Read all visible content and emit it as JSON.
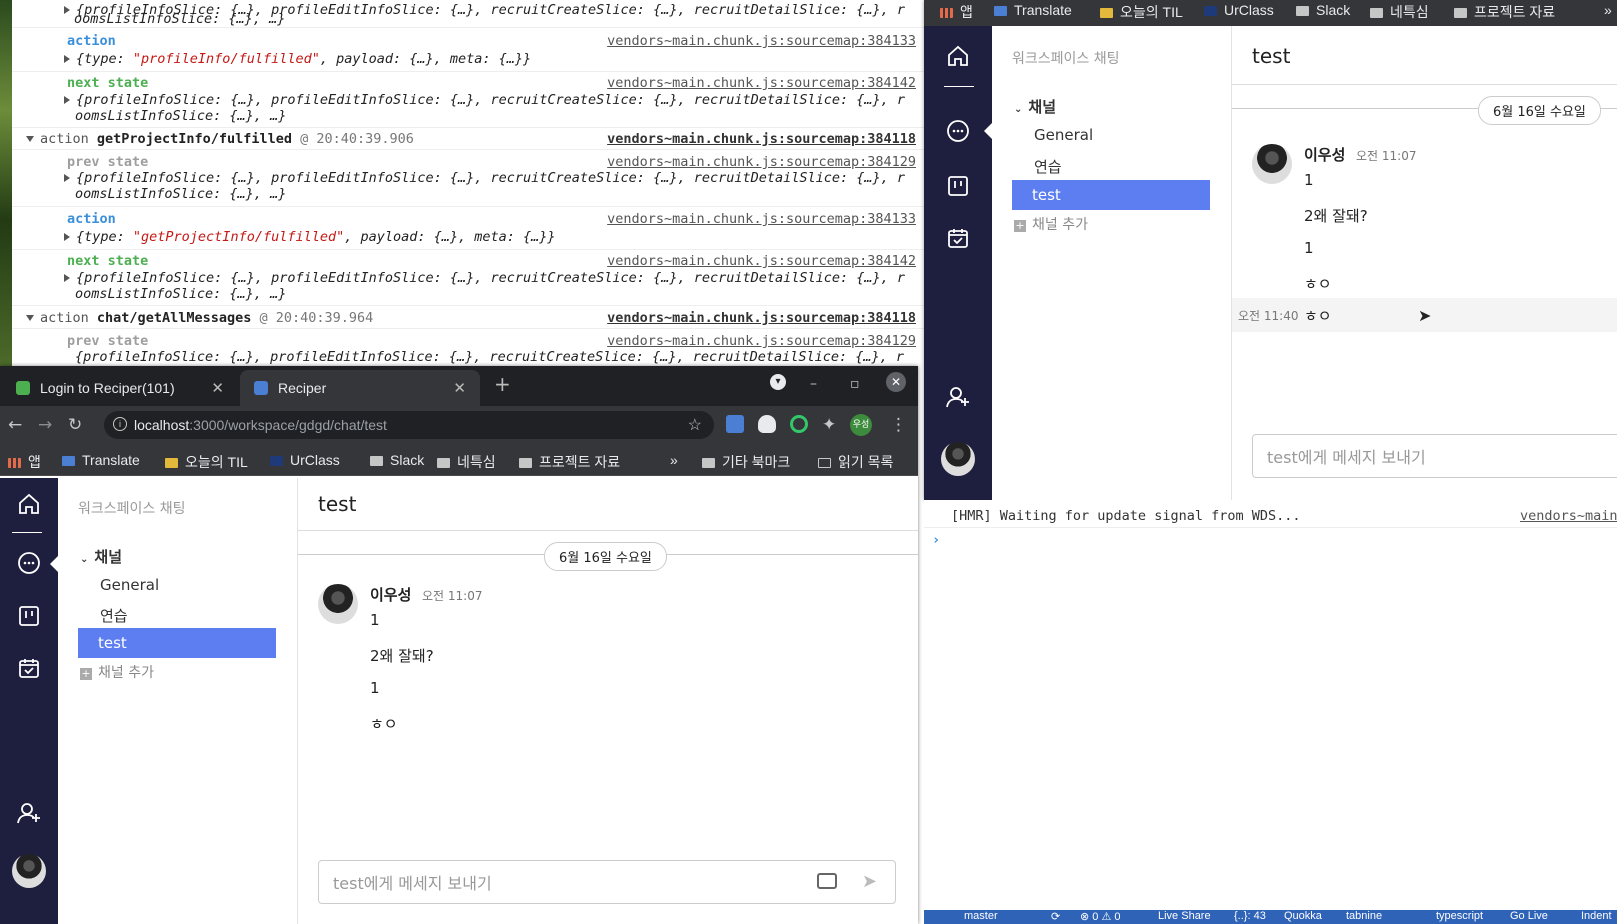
{
  "console": {
    "rows": [
      {
        "text": "{profileInfoSlice: {…}, profileEditInfoSlice: {…}, recruitCreateSlice: {…}, recruitDetailSlice: {…}, r"
      },
      {
        "text": "oomsListInfoSlice: {…}, …}"
      }
    ],
    "group1": {
      "action_label": "action",
      "action_src": "vendors~main.chunk.js:sourcemap:384133",
      "action_obj_pre": "{type: ",
      "action_type": "\"profileInfo/fulfilled\"",
      "action_obj_post": ", payload: {…}, meta: {…}}",
      "next_label": "next state",
      "next_src": "vendors~main.chunk.js:sourcemap:384142",
      "next_line1": "{profileInfoSlice: {…}, profileEditInfoSlice: {…}, recruitCreateSlice: {…}, recruitDetailSlice: {…}, r",
      "next_line2": "oomsListInfoSlice: {…}, …}"
    },
    "group2": {
      "header_action": "action",
      "header_name": "getProjectInfo/fulfilled",
      "header_time": "@ 20:40:39.906",
      "header_src": "vendors~main.chunk.js:sourcemap:384118",
      "prev_label": "prev state",
      "prev_src": "vendors~main.chunk.js:sourcemap:384129",
      "prev_line1": "{profileInfoSlice: {…}, profileEditInfoSlice: {…}, recruitCreateSlice: {…}, recruitDetailSlice: {…}, r",
      "prev_line2": "oomsListInfoSlice: {…}, …}",
      "action_label": "action",
      "action_src": "vendors~main.chunk.js:sourcemap:384133",
      "action_obj_pre": "{type: ",
      "action_type": "\"getProjectInfo/fulfilled\"",
      "action_obj_post": ", payload: {…}, meta: {…}}",
      "next_label": "next state",
      "next_src": "vendors~main.chunk.js:sourcemap:384142",
      "next_line1": "{profileInfoSlice: {…}, profileEditInfoSlice: {…}, recruitCreateSlice: {…}, recruitDetailSlice: {…}, r",
      "next_line2": "oomsListInfoSlice: {…}, …}"
    },
    "group3": {
      "header_action": "action",
      "header_name": "chat/getAllMessages",
      "header_time": "@ 20:40:39.964",
      "header_src": "vendors~main.chunk.js:sourcemap:384118",
      "prev_label": "prev state",
      "prev_src": "vendors~main.chunk.js:sourcemap:384129",
      "prev_line1": "{profileInfoSlice: {…}, profileEditInfoSlice: {…}, recruitCreateSlice: {…}, recruitDetailSlice: {…}, r"
    }
  },
  "browser": {
    "tabs": [
      {
        "label": "Login to Reciper(101)",
        "favicon_color": "#4caf50"
      },
      {
        "label": "Reciper",
        "favicon_color": "#4a7fd4"
      }
    ],
    "url_host": "localhost",
    "url_path": ":3000/workspace/gdgd/chat/test",
    "bookmarks": [
      "앱",
      "Translate",
      "오늘의 TIL",
      "UrClass",
      "Slack",
      "네특심",
      "프로젝트 자료",
      "»",
      "기타 북마크",
      "읽기 목록"
    ],
    "profile_badge": "우성"
  },
  "app": {
    "workspace_label": "워크스페이스 채팅",
    "channels_header": "채널",
    "channels": [
      "General",
      "연습",
      "test"
    ],
    "selected_channel": "test",
    "add_channel": "채널 추가",
    "chat_title": "test",
    "date_divider": "6월 16일 수요일",
    "author": "이우성",
    "author_time": "오전 11:07",
    "messages": [
      "1",
      "2왜 잘돼?",
      "1",
      "ㅎㅇ"
    ],
    "extra_message_time": "오전 11:40",
    "extra_message": "ㅎㅇ",
    "input_placeholder": "test에게 메세지 보내기",
    "accent_color": "#5c7ef0",
    "rail_color": "#1e1e3f"
  },
  "right_bookmarks": [
    "앱",
    "Translate",
    "오늘의 TIL",
    "UrClass",
    "Slack",
    "네특심",
    "프로젝트 자료",
    "»"
  ],
  "rconsole": {
    "hmr": "[HMR] Waiting for update signal from WDS...",
    "hmr_src": "vendors~main"
  },
  "statusbar": [
    "master",
    "⟳",
    "⊗ 0 ⚠ 0",
    "Live Share",
    "{..}: 43",
    "Quokka",
    "tabnine",
    "typescript",
    "Go Live",
    "Indent"
  ]
}
